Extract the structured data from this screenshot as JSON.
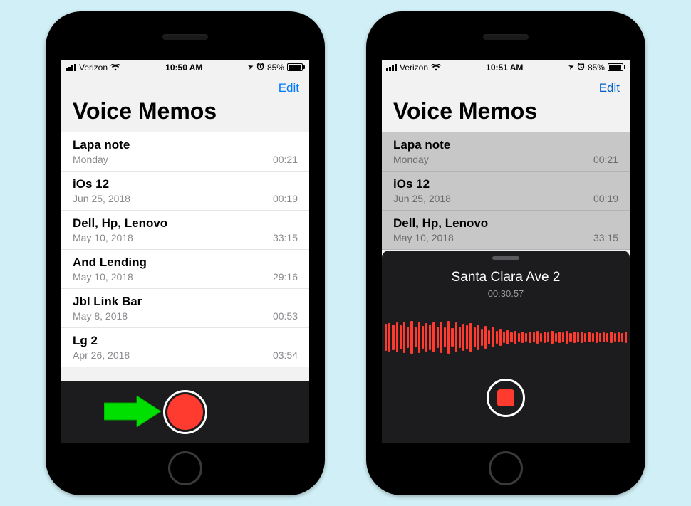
{
  "phone1": {
    "status": {
      "carrier": "Verizon",
      "time": "10:50 AM",
      "battery_pct": "85%"
    },
    "nav": {
      "edit": "Edit"
    },
    "title": "Voice Memos",
    "memos": [
      {
        "title": "Lapa note",
        "date": "Monday",
        "dur": "00:21"
      },
      {
        "title": "iOs 12",
        "date": "Jun 25, 2018",
        "dur": "00:19"
      },
      {
        "title": "Dell, Hp, Lenovo",
        "date": "May 10, 2018",
        "dur": "33:15"
      },
      {
        "title": "And Lending",
        "date": "May 10, 2018",
        "dur": "29:16"
      },
      {
        "title": "Jbl Link Bar",
        "date": "May 8, 2018",
        "dur": "00:53"
      },
      {
        "title": "Lg 2",
        "date": "Apr 26, 2018",
        "dur": "03:54"
      }
    ]
  },
  "phone2": {
    "status": {
      "carrier": "Verizon",
      "time": "10:51 AM",
      "battery_pct": "85%"
    },
    "nav": {
      "edit": "Edit"
    },
    "title": "Voice Memos",
    "memos": [
      {
        "title": "Lapa note",
        "date": "Monday",
        "dur": "00:21"
      },
      {
        "title": "iOs 12",
        "date": "Jun 25, 2018",
        "dur": "00:19"
      },
      {
        "title": "Dell, Hp, Lenovo",
        "date": "May 10, 2018",
        "dur": "33:15"
      }
    ],
    "recording": {
      "name": "Santa Clara Ave 2",
      "elapsed": "00:30.57"
    }
  },
  "icons": {
    "location": "➤",
    "alarm": "⏰"
  }
}
